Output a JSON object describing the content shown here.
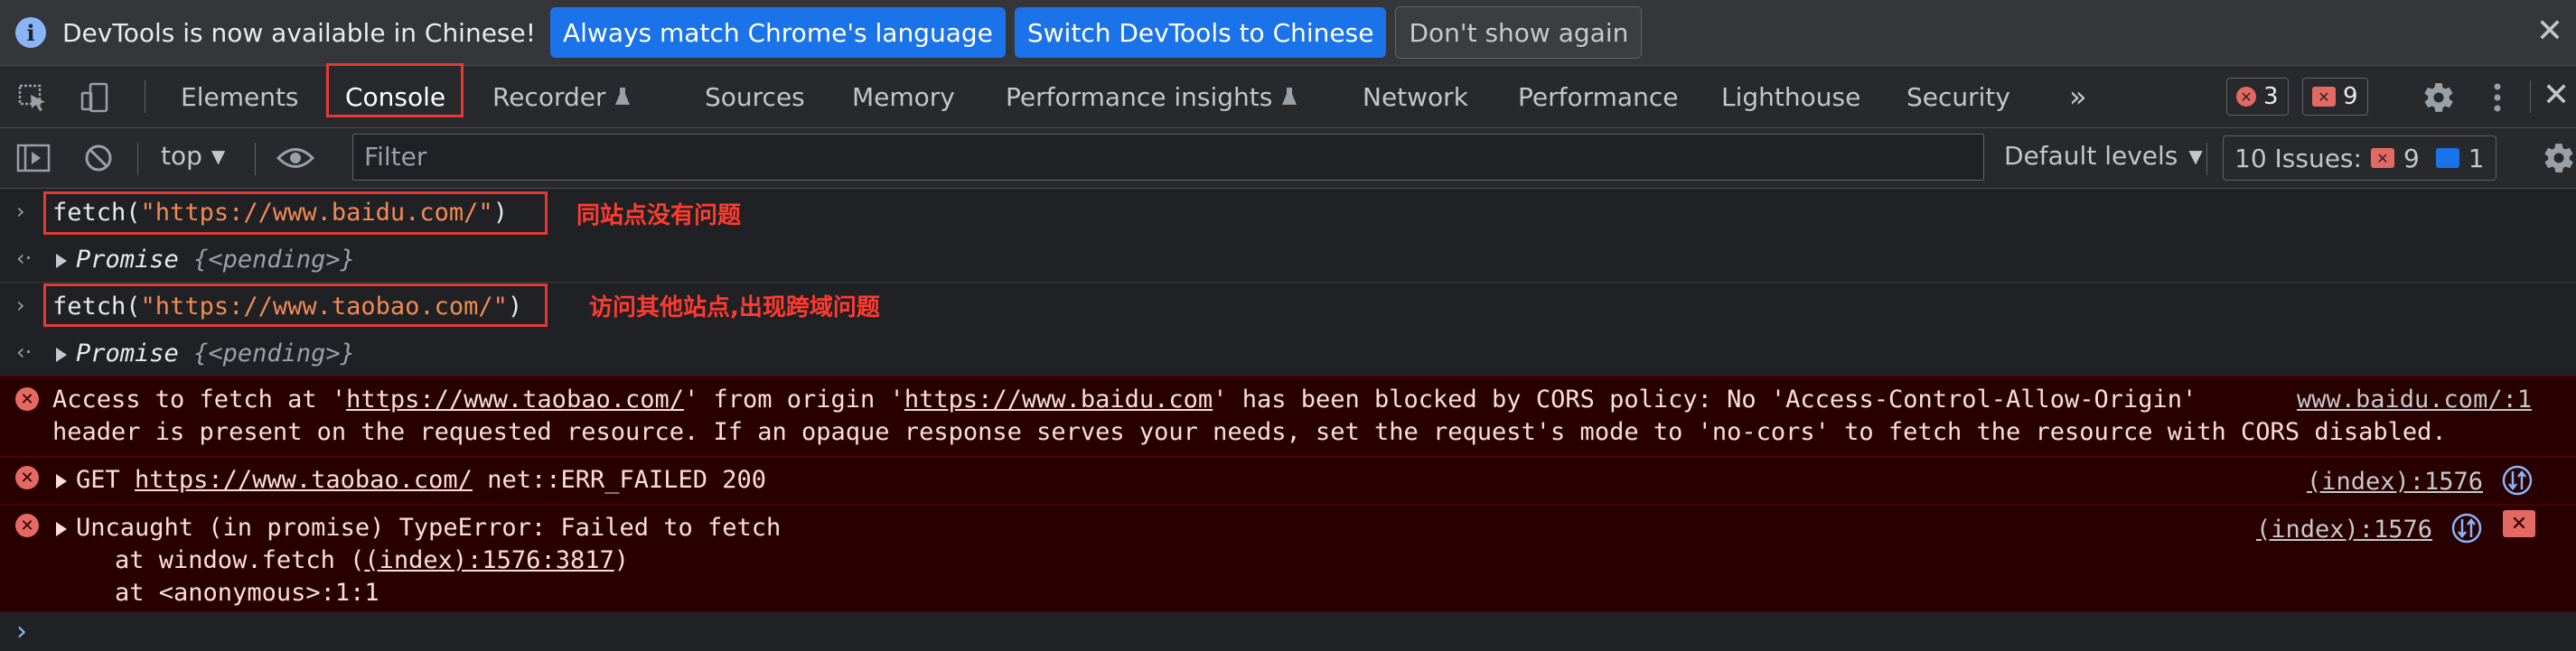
{
  "infobar": {
    "message": "DevTools is now available in Chinese!",
    "btn_match": "Always match Chrome's language",
    "btn_switch": "Switch DevTools to Chinese",
    "btn_dismiss": "Don't show again"
  },
  "tabs": {
    "elements": "Elements",
    "console": "Console",
    "recorder": "Recorder",
    "sources": "Sources",
    "memory": "Memory",
    "perf_insights": "Performance insights",
    "network": "Network",
    "performance": "Performance",
    "lighthouse": "Lighthouse",
    "security": "Security",
    "more": "»"
  },
  "badges": {
    "errors": "3",
    "issues": "9"
  },
  "toolbar": {
    "context": "top",
    "filter_placeholder": "Filter",
    "levels": "Default levels",
    "issues_label": "10 Issues:",
    "issues_errors": "9",
    "issues_info": "1"
  },
  "console": {
    "line1_code": "fetch(",
    "line1_str": "\"https://www.baidu.com/\"",
    "line1_end": ")",
    "annotation1": "同站点没有问题",
    "promise1_keyword": "Promise",
    "promise1_state": "{<pending>}",
    "line2_code": "fetch(",
    "line2_str": "\"https://www.taobao.com/\"",
    "line2_end": ")",
    "annotation2": "访问其他站点,出现跨域问题",
    "promise2_keyword": "Promise",
    "promise2_state": "{<pending>}",
    "err1_a": "Access to fetch at '",
    "err1_url1": "https://www.taobao.com/",
    "err1_b": "' from origin '",
    "err1_url2": "https://www.baidu.com",
    "err1_c": "' has been blocked by CORS policy: No 'Access-Control-Allow-Origin'",
    "err1_line2": "header is present on the requested resource. If an opaque response serves your needs, set the request's mode to 'no-cors' to fetch the resource with CORS disabled.",
    "err1_src": "www.baidu.com/:1",
    "err2_method": "GET",
    "err2_url": "https://www.taobao.com/",
    "err2_msg": "net::ERR_FAILED 200",
    "err2_src": "(index):1576",
    "err3_msg": "Uncaught (in promise) TypeError: Failed to fetch",
    "err3_stack1_a": "    at window.fetch (",
    "err3_stack1_link": "(index):1576:3817",
    "err3_stack1_b": ")",
    "err3_stack2": "    at <anonymous>:1:1",
    "err3_src": "(index):1576"
  },
  "colors": {
    "accent": "#1a73e8",
    "error_bg": "#290000",
    "annotation": "#ff3b30"
  }
}
